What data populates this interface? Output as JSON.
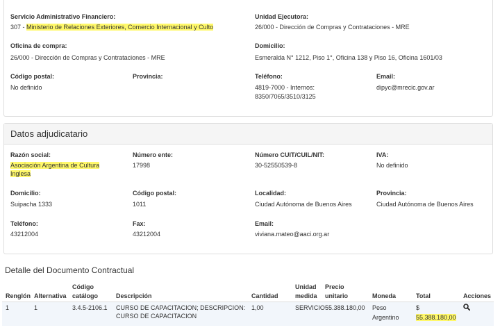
{
  "org": {
    "servicio": {
      "label": "Servicio Administrativo Financiero:",
      "code": "307 - ",
      "value": "Ministerio de Relaciones Exteriores, Comercio Internacional y Culto"
    },
    "unidad": {
      "label": "Unidad Ejecutora:",
      "value": "26/000 - Dirección de Compras y Contrataciones - MRE"
    },
    "oficina": {
      "label": "Oficina de compra:",
      "value": "26/000 - Dirección de Compras y Contrataciones - MRE"
    },
    "domicilio": {
      "label": "Domicilio:",
      "value": "Esmeralda N° 1212, Piso 1°, Oficina 138 y Piso 16, Oficina 1601/03"
    },
    "codigo_postal": {
      "label": "Código postal:",
      "value": "No definido"
    },
    "provincia": {
      "label": "Provincia:",
      "value": ""
    },
    "telefono": {
      "label": "Teléfono:",
      "line1": "4819-7000 - Internos:",
      "line2": "8350/7065/3510/3125"
    },
    "email": {
      "label": "Email:",
      "value": "dipyc@mrecic.gov.ar"
    }
  },
  "adj": {
    "title": "Datos adjudicatario",
    "razon": {
      "label": "Razón social:",
      "line1": "Asociación Argentina de Cultura",
      "line2": "Inglesa"
    },
    "numero_ente": {
      "label": "Número ente:",
      "value": "17998"
    },
    "cuit": {
      "label": "Número CUIT/CUIL/NIT:",
      "value": "30-52550539-8"
    },
    "iva": {
      "label": "IVA:",
      "value": "No definido"
    },
    "domicilio": {
      "label": "Domicilio:",
      "value": "Suipacha 1333"
    },
    "codigo_postal": {
      "label": "Código postal:",
      "value": "1011"
    },
    "localidad": {
      "label": "Localidad:",
      "value": "Ciudad Autónoma de Buenos Aires"
    },
    "provincia": {
      "label": "Provincia:",
      "value": "Ciudad Autónoma de Buenos Aires"
    },
    "telefono": {
      "label": "Teléfono:",
      "value": "43212004"
    },
    "fax": {
      "label": "Fax:",
      "value": "43212004"
    },
    "email": {
      "label": "Email:",
      "value": "viviana.mateo@aaci.org.ar"
    }
  },
  "detalle": {
    "title": "Detalle del Documento Contractual",
    "headers": {
      "renglon": "Renglón",
      "alternativa": "Alternativa",
      "codigo_1": "Código",
      "codigo_2": "catálogo",
      "descripcion": "Descripción",
      "cantidad": "Cantidad",
      "unidad_1": "Unidad",
      "unidad_2": "medida",
      "precio_1": "Precio",
      "precio_2": "unitario",
      "moneda": "Moneda",
      "total": "Total",
      "acciones": "Acciones"
    },
    "row": {
      "renglon": "1",
      "alternativa": "1",
      "codigo": "3.4.5-2106.1",
      "desc_1": "CURSO DE CAPACITACION; DESCRIPCION:",
      "desc_2": "CURSO DE CAPACITACION",
      "cantidad": "1,00",
      "unidad": "SERVICIO",
      "precio": "55.388.180,00",
      "moneda_1": "Peso",
      "moneda_2": "Argentino",
      "total_symbol": "$",
      "total_value": "55.388.180,00"
    },
    "action_icon": "search-icon"
  },
  "colors": {
    "highlight": "#fff86a",
    "panel_heading": "#f5f5f5",
    "row_bg": "#f2f6fb",
    "border": "#dddddd"
  }
}
